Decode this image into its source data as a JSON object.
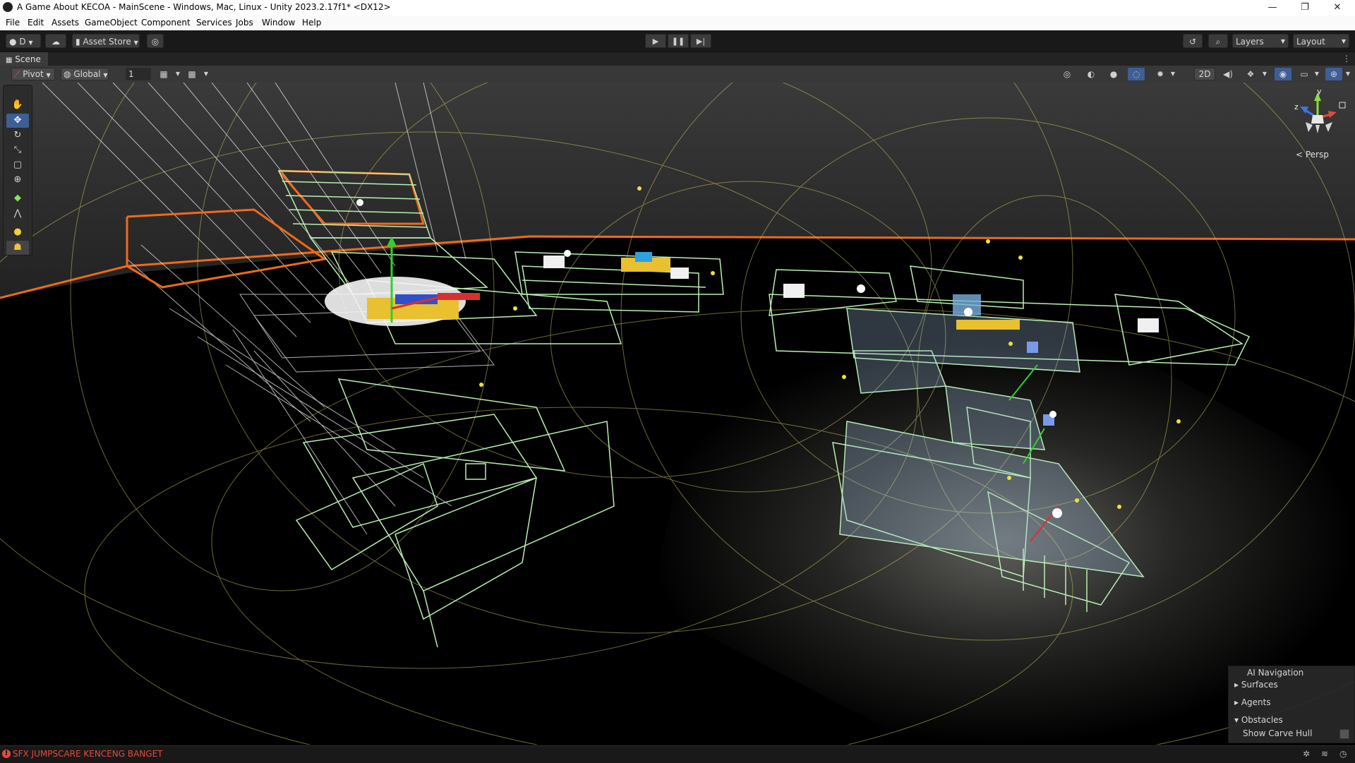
{
  "window": {
    "title": "A Game About KECOA - MainScene - Windows, Mac, Linux - Unity 2023.2.17f1* <DX12>",
    "controls": {
      "minimize": "—",
      "maximize": "❐",
      "close": "✕"
    }
  },
  "menu": {
    "items": [
      "File",
      "Edit",
      "Assets",
      "GameObject",
      "Component",
      "Services",
      "Jobs",
      "Window",
      "Help"
    ]
  },
  "toolbar": {
    "account_label": "D",
    "asset_store_label": "Asset Store",
    "play_icons": {
      "play": "▶",
      "pause": "❚❚",
      "step": "▶|"
    },
    "layers_label": "Layers",
    "layout_label": "Layout"
  },
  "scene_tab": {
    "label": "Scene"
  },
  "scene_toolbar": {
    "pivot_label": "Pivot",
    "global_label": "Global",
    "grid_value": "1",
    "mode_2d_label": "2D"
  },
  "gizmo": {
    "persp_label": "< Persp",
    "axis_y": "y",
    "axis_z": "z",
    "axis_x": "x"
  },
  "ai_navigation": {
    "title": "AI Navigation",
    "sections": [
      "Surfaces",
      "Agents",
      "Obstacles"
    ],
    "option_label": "Show Carve Hull"
  },
  "statusbar": {
    "message": "SFX JUMPSCARE KENCENG BANGET"
  },
  "colors": {
    "accent_orange": "#f06a1a",
    "wire_green": "#b8f0b0",
    "gizmo_yellow": "#c8c05a",
    "error_red": "#e84a3a",
    "selection_blue": "#3e5f96"
  }
}
